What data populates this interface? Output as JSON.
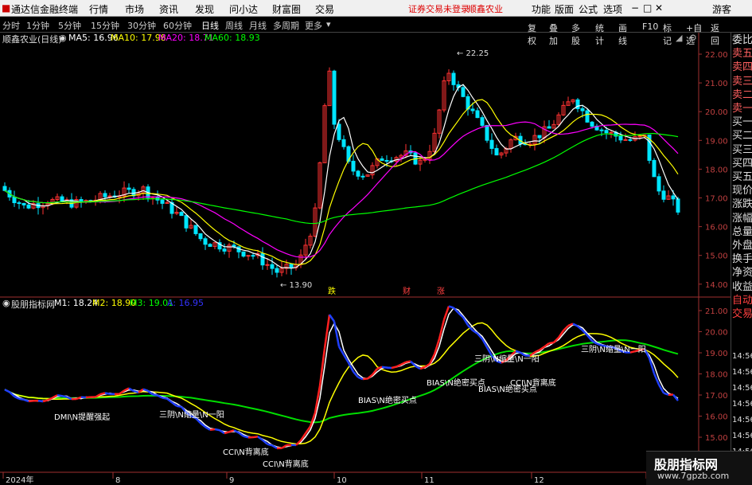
{
  "menubar": {
    "app_title": "通达信金融终端",
    "menus": [
      "行情",
      "市场",
      "资讯",
      "发现",
      "问小达",
      "财富圈",
      "交易"
    ],
    "notice": "证券交易未登录",
    "stock_name": "顺鑫农业",
    "right_menus": [
      "功能",
      "版面",
      "公式",
      "选项"
    ],
    "guest": "游客",
    "window_controls": [
      "−",
      "□",
      "✕"
    ]
  },
  "periodbar": {
    "periods": [
      "分时",
      "1分钟",
      "5分钟",
      "15分钟",
      "30分钟",
      "60分钟",
      "日线",
      "周线",
      "月线",
      "多周期",
      "更多"
    ],
    "active_period": "日线",
    "right_tools": [
      "复权",
      "叠加",
      "多股",
      "统计",
      "画线",
      "F10",
      "标记",
      "+自选",
      "返回"
    ]
  },
  "main_info": {
    "title": "顺鑫农业(日线)",
    "ma5": "MA5: 16.96",
    "ma10": "MA10: 17.98",
    "ma20": "MA20: 18.71",
    "ma60": "MA60: 18.93",
    "colors": {
      "ma5": "#ffffff",
      "ma10": "#ffff00",
      "ma20": "#ff00ff",
      "ma60": "#00ff00"
    }
  },
  "price_axis": [
    "22.00",
    "21.00",
    "20.00",
    "19.00",
    "18.00",
    "17.00",
    "16.00",
    "15.00",
    "14.00"
  ],
  "annotations": {
    "high": "22.25",
    "low": "13.90",
    "markers": [
      "跌",
      "财",
      "涨"
    ]
  },
  "indicator_info": {
    "title": "股朋指标网",
    "m1": "M1: 18.24",
    "m2": "M2: 18.90",
    "m3": "M3: 19.01",
    "a": "A: 16.95"
  },
  "indicator_axis": [
    "21.00",
    "20.00",
    "19.00",
    "18.00",
    "17.00",
    "16.00",
    "15.00"
  ],
  "signals": [
    "DMI\\N提醒强起",
    "三阴\\N缩量\\N一阳",
    "CCI\\N背离底",
    "CCI\\N背离底",
    "BIAS\\N绝密买点",
    "BIAS\\N绝密买点",
    "三阴\\N缩量\\N一阳",
    "BIAS\\N绝密买点",
    "CCI\\N背离底",
    "三阴\\N缩量\\N一阳"
  ],
  "time_axis": [
    "2024年",
    "8",
    "9",
    "10",
    "11",
    "12",
    "1"
  ],
  "side_panel": {
    "top_labels": [
      "委比",
      "卖五",
      "卖四",
      "卖三",
      "卖二",
      "卖一",
      "买一",
      "买二",
      "买三",
      "买四",
      "买五",
      "现价",
      "涨跌",
      "涨幅",
      "总量",
      "外盘",
      "换手",
      "净资",
      "收益",
      "自动",
      "交易"
    ],
    "time_labels": [
      "14:56",
      "14:56",
      "14:56",
      "14:56",
      "14:56",
      "14:56",
      "14:56",
      "14:56"
    ]
  },
  "watermark": {
    "name": "股朋指标网",
    "url": "www.7gpzb.com"
  }
}
